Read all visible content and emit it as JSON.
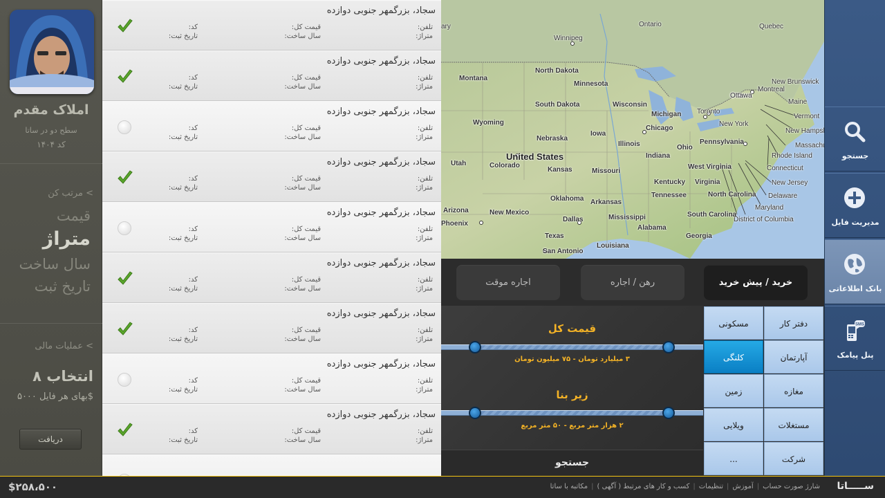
{
  "profile": {
    "name": "املاک مقدم",
    "subtitle": "سطح دو در ساتا",
    "code": "کد ۱۴۰۴"
  },
  "sort": {
    "title": "مرتب کن <",
    "items": [
      "قیمت",
      "متراژ",
      "سال ساخت",
      "تاریخ ثبت"
    ],
    "active_index": 1
  },
  "finance": {
    "title": "عملیات مالی <",
    "selected": "۸ انتخاب",
    "price_per_file": "بهای هر فایل ۵۰۰۰$",
    "receive_button": "دریافت"
  },
  "listing_labels": {
    "phone": "تلفن:",
    "area": "متراژ:",
    "total_price": "قیمت کل:",
    "build_year": "سال ساخت:",
    "code": "کد:",
    "reg_date": "تاریخ ثبت:"
  },
  "listings": [
    {
      "title": "سجاد، بزرگمهر جنوبی دوازده",
      "selected": true
    },
    {
      "title": "سجاد، بزرگمهر جنوبی دوازده",
      "selected": true
    },
    {
      "title": "سجاد، بزرگمهر جنوبی دوازده",
      "selected": false
    },
    {
      "title": "سجاد، بزرگمهر جنوبی دوازده",
      "selected": true
    },
    {
      "title": "سجاد، بزرگمهر جنوبی دوازده",
      "selected": false
    },
    {
      "title": "سجاد، بزرگمهر جنوبی دوازده",
      "selected": true
    },
    {
      "title": "سجاد، بزرگمهر جنوبی دوازده",
      "selected": true
    },
    {
      "title": "سجاد، بزرگمهر جنوبی دوازده",
      "selected": false
    },
    {
      "title": "سجاد، بزرگمهر جنوبی دوازده",
      "selected": true
    },
    {
      "title": "",
      "selected": false
    }
  ],
  "map": {
    "country": "United States",
    "labels": [
      "Ontario",
      "Quebec",
      "Winnipeg",
      "Montreal",
      "New Brunswick",
      "Ottawa",
      "Maine",
      "Toronto",
      "Vermont",
      "New York",
      "New Hampshire",
      "Massachusetts",
      "Rhode Island",
      "Connecticut",
      "New Jersey",
      "Delaware",
      "Maryland",
      "District of Columbia",
      "Montana",
      "North Dakota",
      "Minnesota",
      "South Dakota",
      "Wisconsin",
      "Michigan",
      "Wyoming",
      "Nebraska",
      "Iowa",
      "Chicago",
      "Illinois",
      "Ohio",
      "Pennsylvania",
      "Indiana",
      "Utah",
      "Colorado",
      "Kansas",
      "Missouri",
      "West Virginia",
      "Virginia",
      "Kentucky",
      "Tennessee",
      "North Carolina",
      "South Carolina",
      "Oklahoma",
      "Arkansas",
      "Arizona",
      "Phoenix",
      "New Mexico",
      "Dallas",
      "Mississippi",
      "Alabama",
      "Georgia",
      "Texas",
      "Louisiana",
      "San Antonio",
      "Ottawa",
      "ary"
    ]
  },
  "tabs": {
    "items": [
      "خرید / پیش خرید",
      "رهن / اجاره",
      "اجاره موقت"
    ],
    "active_index": 0
  },
  "filters": {
    "price_title": "قیمت کل",
    "price_range": "۳ میلیارد تومان - ۷۵ میلیون تومان",
    "area_title": "زیر بنا",
    "area_range": "۲ هزار متر مربع - ۵۰ متر مربع",
    "search_label": "جستجو"
  },
  "categories": {
    "items": [
      [
        "دفتر کار",
        "مسکونی"
      ],
      [
        "آپارتمان",
        "کلنگی"
      ],
      [
        "مغازه",
        "زمین"
      ],
      [
        "مستغلات",
        "ویلایی"
      ],
      [
        "شرکت",
        "..."
      ]
    ],
    "active": "کلنگی"
  },
  "nav": {
    "search": "جستجو",
    "file_management": "مدیریت فایل",
    "data_bank": "بانک اطلاعاتی",
    "sms_panel": "پنل پیامک",
    "active": "data_bank"
  },
  "footer": {
    "logo": "ســـــاتا",
    "links": [
      "شارژ صورت حساب",
      "آموزش",
      "تنظیمات",
      "کسب و کار های مرتبط ( آگهی )",
      "مکاتبه با ساتا"
    ],
    "balance": "$۲۵۸،۵۰۰"
  },
  "colors": {
    "accent_yellow": "#f3b226",
    "nav_blue": "#2e4a72",
    "category_active": "#0a7fc4"
  }
}
